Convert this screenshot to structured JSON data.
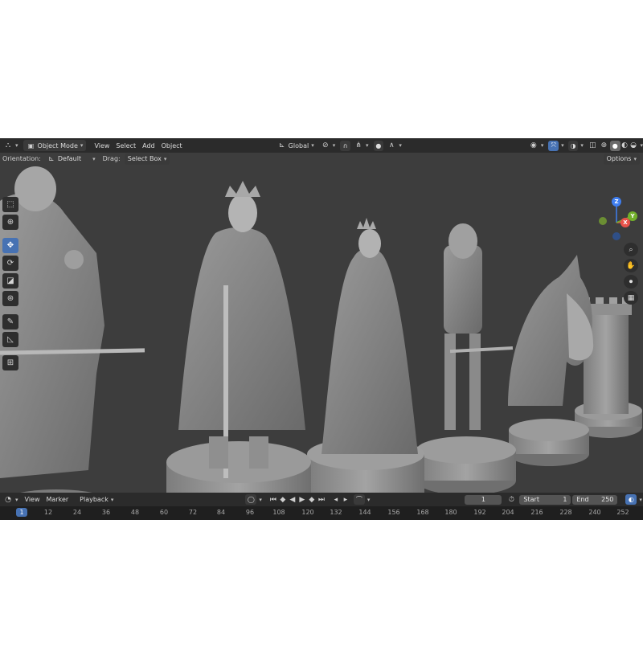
{
  "header": {
    "editor_icon": "3d-viewport-icon",
    "mode": "Object Mode",
    "menus": [
      "View",
      "Select",
      "Add",
      "Object"
    ],
    "transform_orientation": "Global"
  },
  "tool_options": {
    "orientation_label": "Orientation:",
    "orientation_value": "Default",
    "drag_label": "Drag:",
    "drag_value": "Select Box",
    "options_label": "Options"
  },
  "toolbar": {
    "tools": [
      "select-box-icon",
      "cursor-icon",
      "move-icon",
      "rotate-icon",
      "scale-icon",
      "transform-icon",
      "annotate-icon",
      "measure-icon",
      "add-cube-icon"
    ],
    "active_tool": "move-icon"
  },
  "gizmo": {
    "z": "Z",
    "x": "X",
    "y": "Y"
  },
  "timeline": {
    "menus": [
      "View",
      "Marker",
      "Playback"
    ],
    "current_frame": "1",
    "start_label": "Start",
    "start_value": "1",
    "end_label": "End",
    "end_value": "250",
    "ticks": [
      "1",
      "12",
      "24",
      "36",
      "48",
      "60",
      "72",
      "84",
      "96",
      "108",
      "120",
      "132",
      "144",
      "156",
      "168",
      "180",
      "192",
      "204",
      "216",
      "228",
      "240",
      "252"
    ]
  },
  "colors": {
    "accent": "#4772b3",
    "viewport_bg": "#3d3d3d",
    "header_bg": "#2b2b2b",
    "axis_x": "#e8524a",
    "axis_y": "#72b02a",
    "axis_z": "#3f7ef0"
  }
}
